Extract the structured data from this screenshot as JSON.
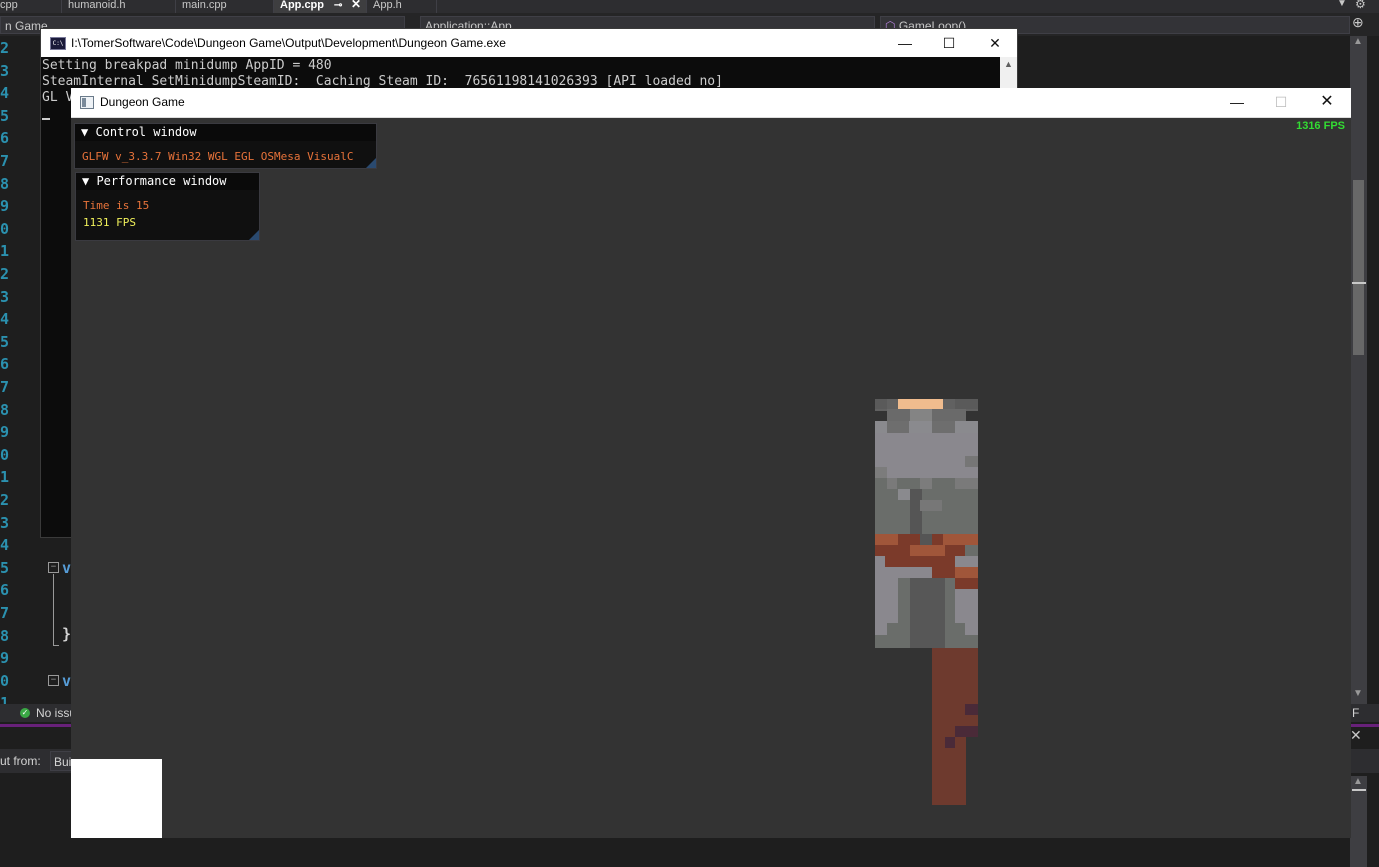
{
  "ide": {
    "tabs": [
      "cpp",
      "humanoid.h",
      "main.cpp",
      "App.cpp",
      "App.h"
    ],
    "active_tab": "App.cpp",
    "solution_combo": "n Game",
    "scope_combo": "Application::App",
    "member_combo": "GameLoop()",
    "line_numbers": [
      "2",
      "3",
      "4",
      "5",
      "6",
      "7",
      "8",
      "9",
      "0",
      "1",
      "2",
      "3",
      "4",
      "5",
      "6",
      "7",
      "8",
      "9",
      "0",
      "1",
      "2",
      "3",
      "4",
      "5",
      "6",
      "7",
      "8",
      "9",
      "0",
      "1"
    ],
    "code_keyword_1": "v",
    "code_keyword_2": "v",
    "code_brace": "}",
    "status_text": "No issu",
    "output_from_label": "ut from:",
    "output_from_value": "Bui"
  },
  "console": {
    "title": "I:\\TomerSoftware\\Code\\Dungeon Game\\Output\\Development\\Dungeon Game.exe",
    "lines": [
      "Setting breakpad minidump AppID = 480",
      "SteamInternal SetMinidumpSteamID:  Caching Steam ID:  76561198141026393 [API loaded no]",
      "GL V"
    ]
  },
  "game": {
    "title": "Dungeon Game",
    "fps_overlay": "1316 FPS",
    "control_window": {
      "title": "▼ Control window",
      "text": "GLFW v_3.3.7 Win32 WGL EGL OSMesa VisualC",
      "text_color": "#e8733a"
    },
    "performance_window": {
      "title": "▼ Performance window",
      "time_text": "Time is 15",
      "fps_text": "1131 FPS",
      "time_color": "#e8733a",
      "fps_color": "#f0f05a"
    }
  },
  "colors": {
    "game_bg": "#333333",
    "fps_green": "#33dd33",
    "line_number_blue": "#2b91af"
  }
}
